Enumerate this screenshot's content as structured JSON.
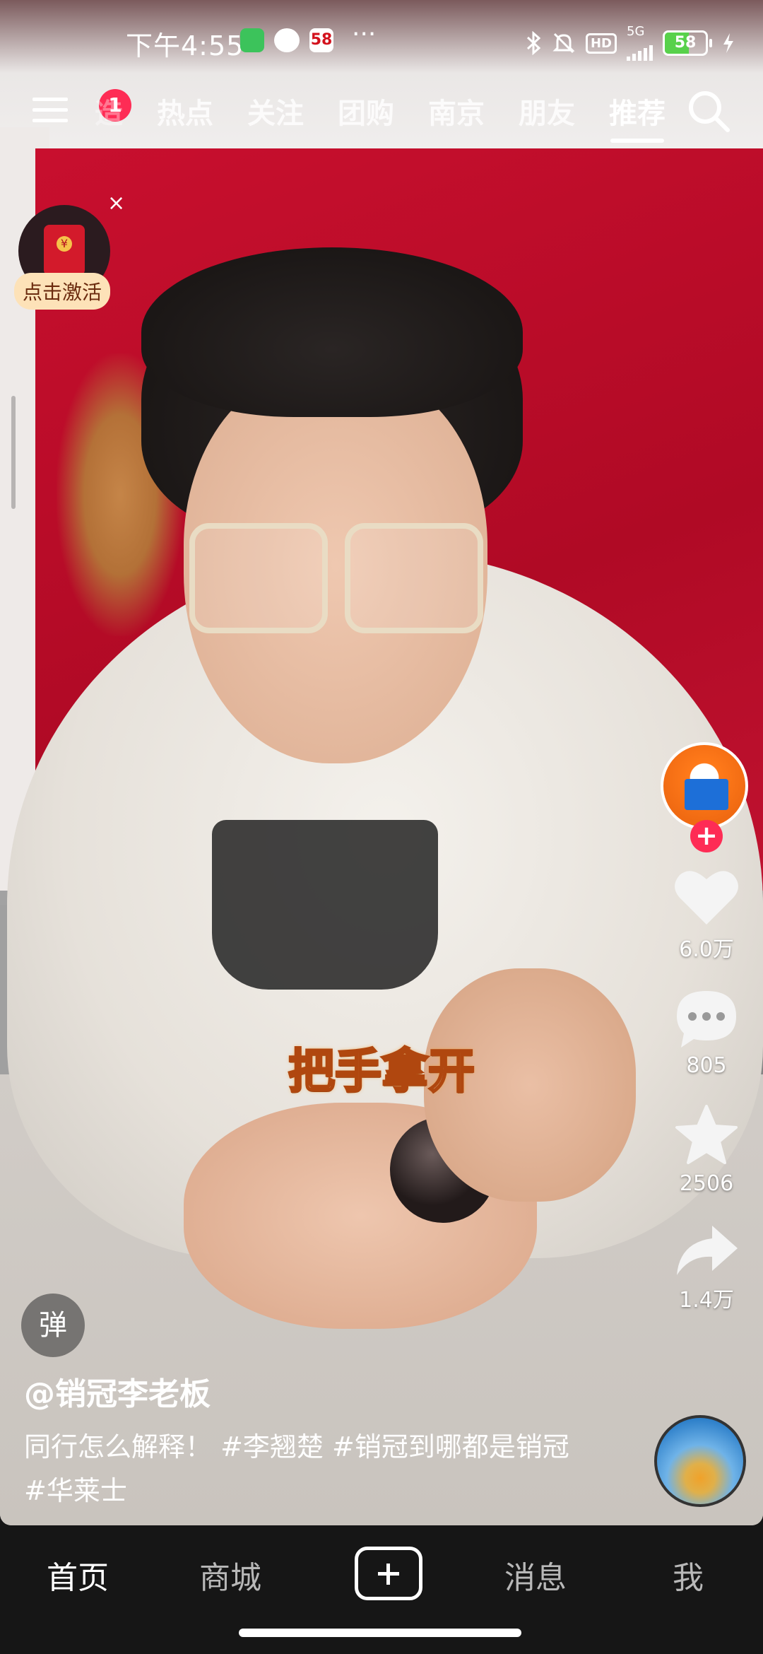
{
  "status_bar": {
    "time": "下午4:55",
    "app_badge_3": "58",
    "more_dots": "···",
    "hd_label": "HD",
    "network": "5G",
    "battery_percent": 58
  },
  "top_nav": {
    "notification_badge": "1",
    "tabs": [
      {
        "label": "热点"
      },
      {
        "label": "关注"
      },
      {
        "label": "团购"
      },
      {
        "label": "南京"
      },
      {
        "label": "朋友"
      },
      {
        "label": "推荐",
        "active": true
      }
    ],
    "partial_tab": "造"
  },
  "redpacket": {
    "label": "点击激活",
    "close": "×"
  },
  "video": {
    "subtitle": "把手拿开",
    "danmu": "弹",
    "author": "@销冠李老板",
    "description": "同行怎么解释！ #李翘楚 #销冠到哪都是销冠 #华莱士"
  },
  "actions": {
    "follow": "+",
    "likes": "6.0万",
    "comments": "805",
    "favorites": "2506",
    "shares": "1.4万"
  },
  "tabbar": {
    "home": "首页",
    "mall": "商城",
    "messages": "消息",
    "me": "我"
  }
}
